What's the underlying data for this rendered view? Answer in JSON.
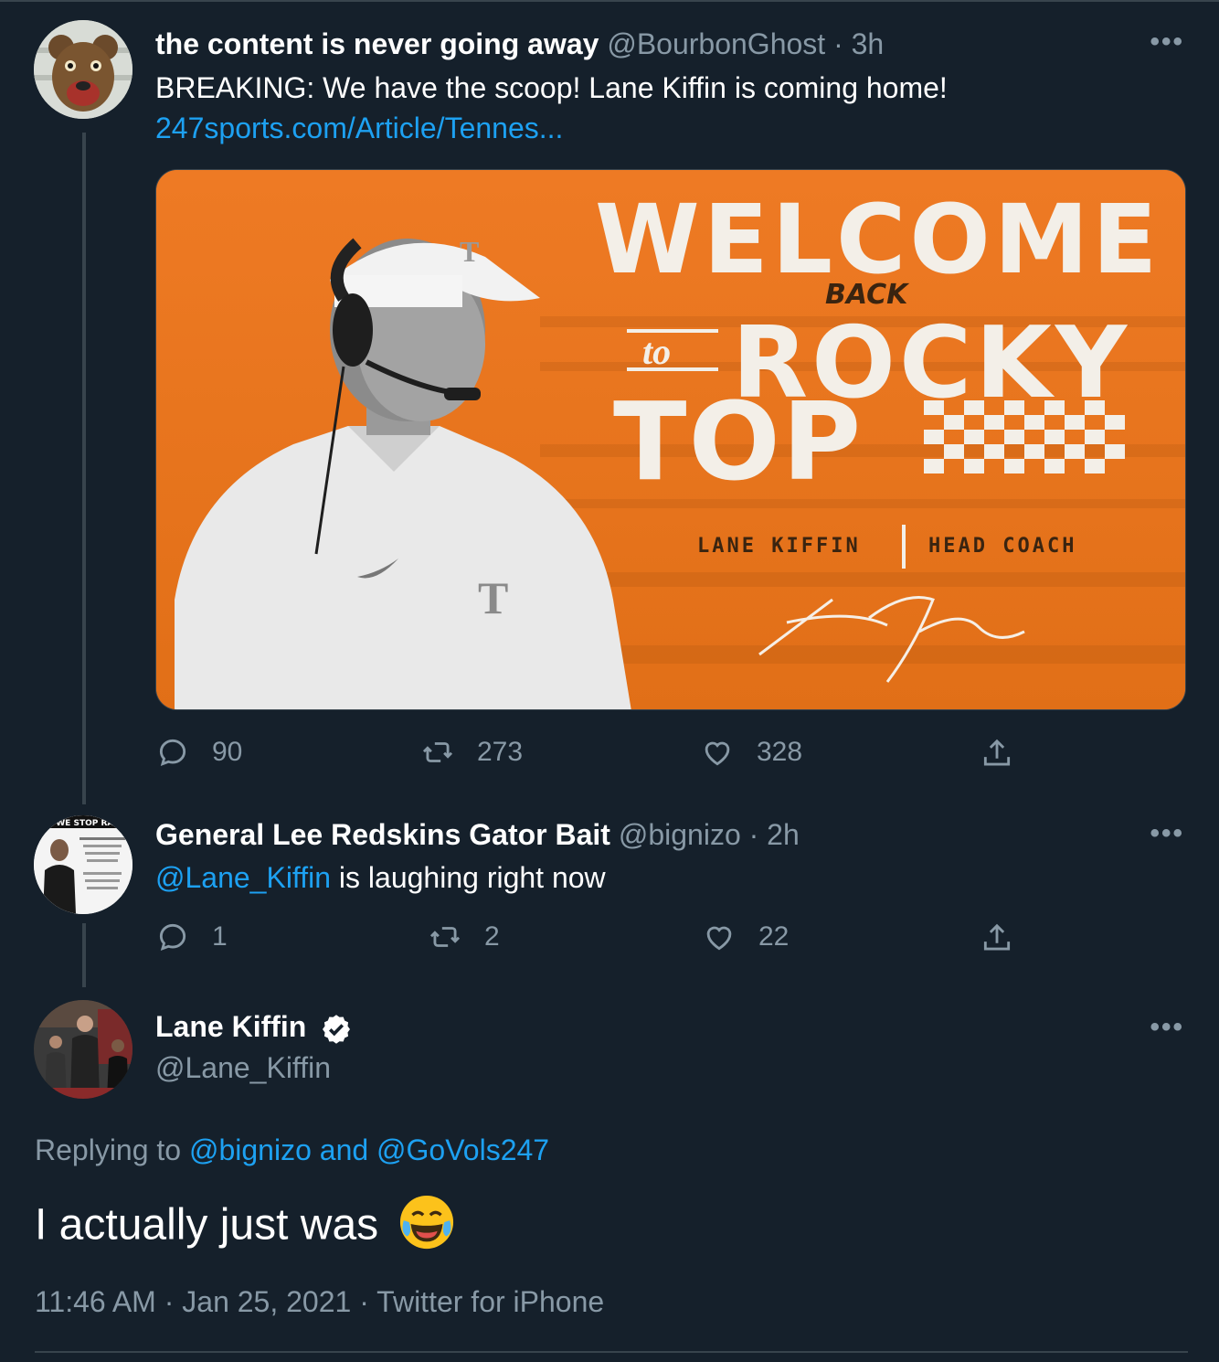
{
  "tweet1": {
    "display_name": "the content is never going away",
    "handle": "@BourbonGhost",
    "separator": "·",
    "time": "3h",
    "text": "BREAKING: We have the scoop! Lane Kiffin is coming home!",
    "link": "247sports.com/Article/Tennes...",
    "card": {
      "line1": "WELCOME",
      "line2": "BACK",
      "line3_small": "to",
      "line3": "ROCKY",
      "line4": "TOP",
      "name": "LANE KIFFIN",
      "role": "HEAD COACH",
      "cap_letter": "T",
      "shirt_letter": "T"
    },
    "replies": "90",
    "retweets": "273",
    "likes": "328"
  },
  "tweet2": {
    "display_name": "General Lee Redskins Gator Bait",
    "handle": "@bignizo",
    "separator": "·",
    "time": "2h",
    "mention": "@Lane_Kiffin",
    "text": " is laughing right now",
    "avatar_caption": "DO WE STOP RAC",
    "replies": "1",
    "retweets": "2",
    "likes": "22"
  },
  "main": {
    "display_name": "Lane Kiffin",
    "handle": "@Lane_Kiffin",
    "replying_prefix": "Replying to ",
    "replying_to": "@bignizo and @GoVols247",
    "text": "I actually just was",
    "emoji": "😂",
    "timestamp": "11:46 AM · Jan 25, 2021 · Twitter for iPhone"
  },
  "more_label": "•••",
  "colors": {
    "background": "#15202b",
    "link": "#1da1f2",
    "muted": "#8899a6",
    "border": "#38444d",
    "card_orange": "#e8731c"
  }
}
